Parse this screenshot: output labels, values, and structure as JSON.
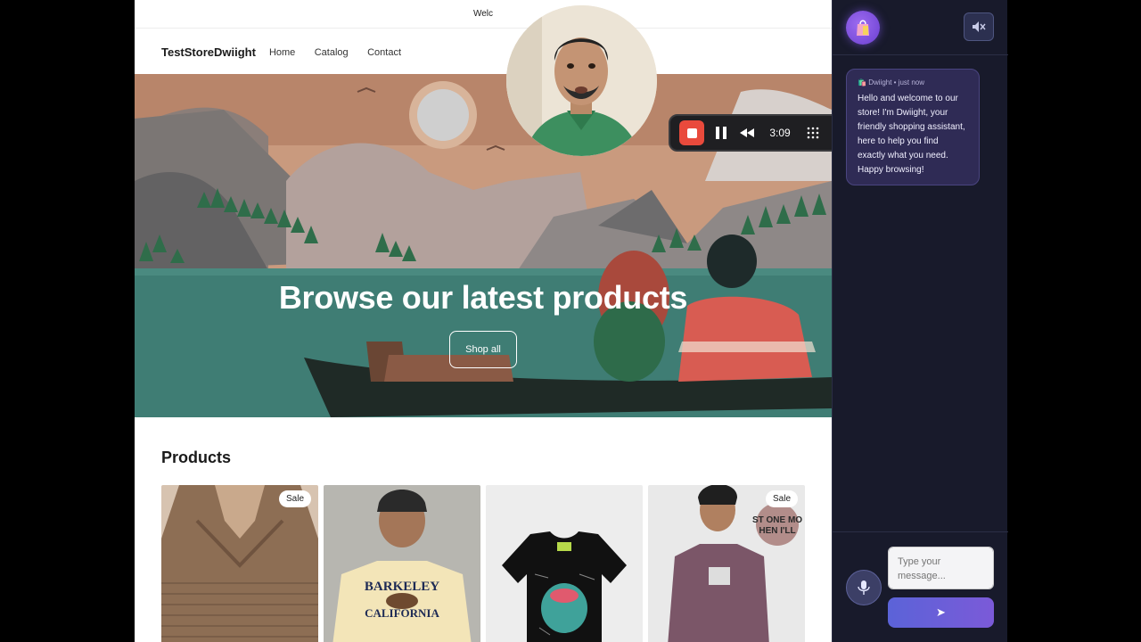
{
  "store": {
    "announcement": "Welc",
    "brand": "TestStoreDwiight",
    "nav": [
      "Home",
      "Catalog",
      "Contact"
    ],
    "hero_title": "Browse our latest products",
    "hero_button": "Shop all",
    "products_heading": "Products",
    "badges": {
      "sale": "Sale"
    }
  },
  "recorder": {
    "time": "3:09"
  },
  "chat": {
    "author": "Dwiight",
    "meta_sep": " • ",
    "time": "just now",
    "message": "Hello and welcome to our store! I'm Dwiight, your friendly shopping assistant, here to help you find exactly what you need. Happy browsing!",
    "input_placeholder": "Type your message...",
    "send_icon": "➤",
    "mic_icon": "microphone-icon",
    "mute_icon": "speaker-muted-icon",
    "avatar_icon": "shopping-bag-icon"
  },
  "colors": {
    "panel_bg": "#181a2b",
    "bubble_bg": "#2f2b55",
    "send_gradient": [
      "#5b63d8",
      "#7b5ad8"
    ],
    "stop_red": "#e94a3c"
  }
}
